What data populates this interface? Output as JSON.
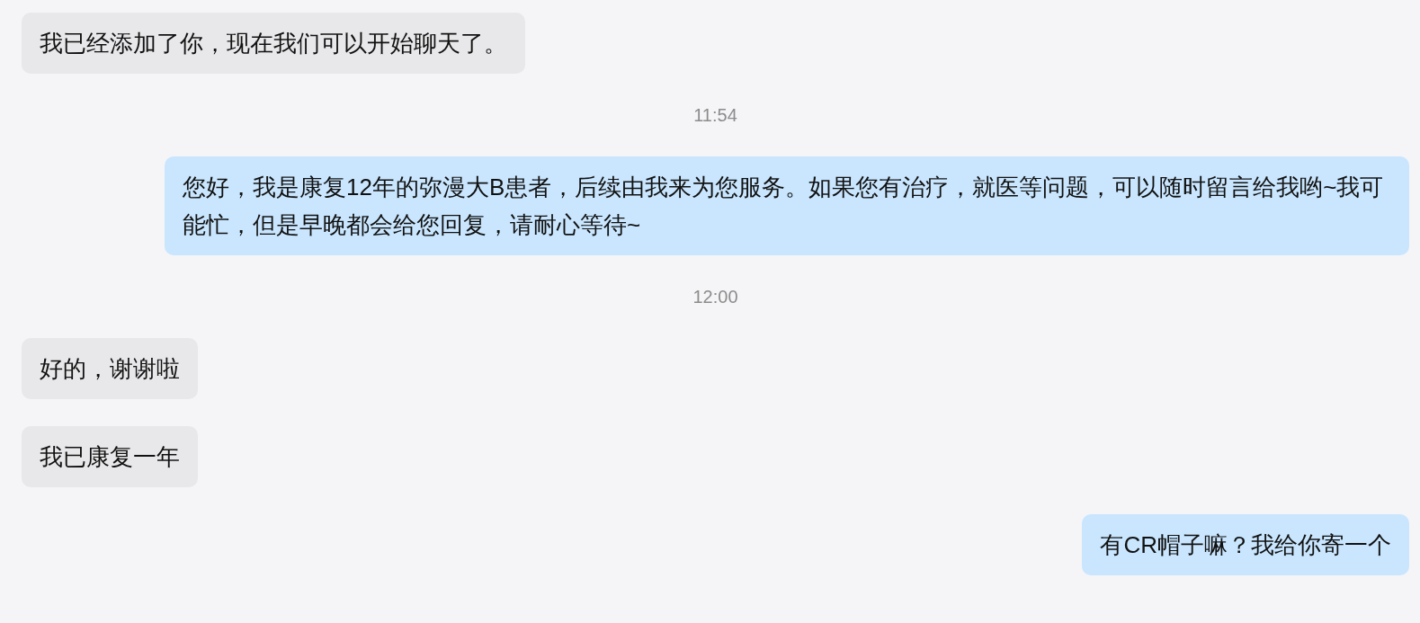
{
  "messages": [
    {
      "kind": "bubble",
      "outgoing": false,
      "text": "我已经添加了你，现在我们可以开始聊天了。"
    },
    {
      "kind": "time",
      "text": "11:54"
    },
    {
      "kind": "bubble",
      "outgoing": true,
      "text": "您好，我是康复12年的弥漫大B患者，后续由我来为您服务。如果您有治疗，就医等问题，可以随时留言给我哟~我可能忙，但是早晚都会给您回复，请耐心等待~"
    },
    {
      "kind": "time",
      "text": "12:00"
    },
    {
      "kind": "bubble",
      "outgoing": false,
      "text": "好的，谢谢啦"
    },
    {
      "kind": "bubble",
      "outgoing": false,
      "text": "我已康复一年"
    },
    {
      "kind": "bubble",
      "outgoing": true,
      "text": "有CR帽子嘛？我给你寄一个"
    }
  ]
}
